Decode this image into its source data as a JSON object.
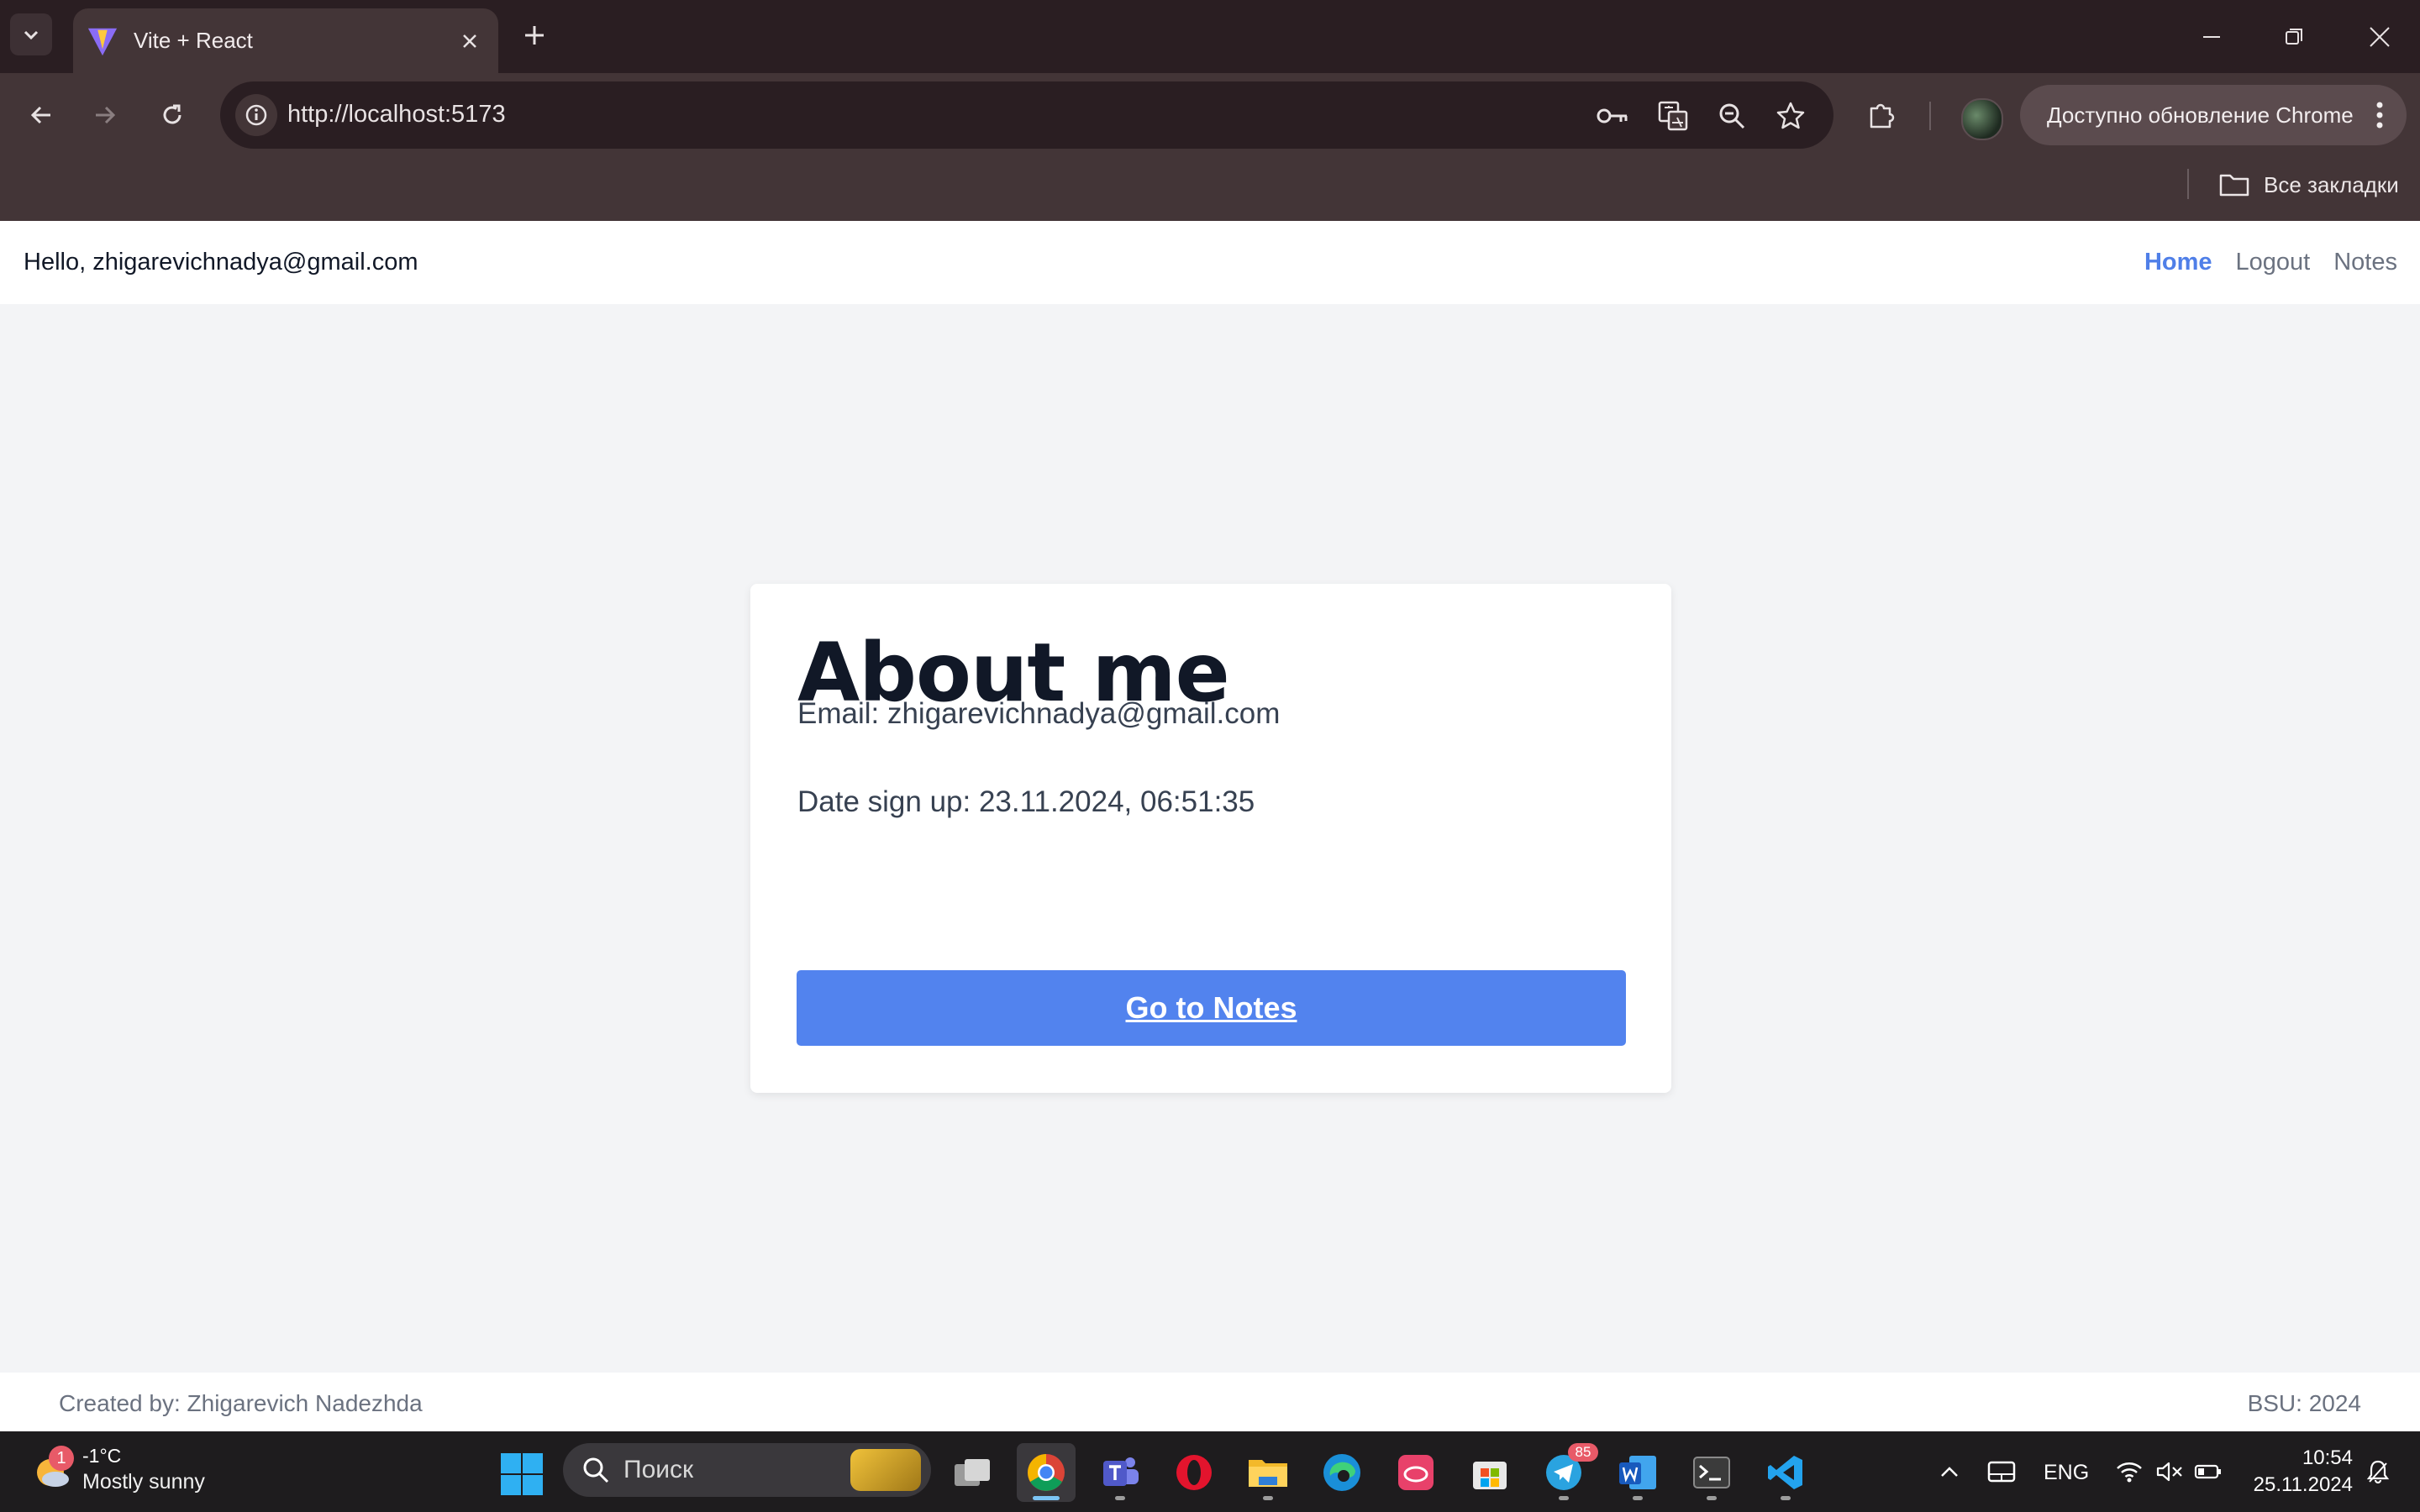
{
  "browser": {
    "tab_title": "Vite + React",
    "url": "http://localhost:5173",
    "update_button_label": "Доступно обновление Chrome",
    "bookmarks_all_label": "Все закладки",
    "icons": [
      "tab-search-icon",
      "vite-favicon",
      "close-icon",
      "new-tab-icon",
      "minimize-icon",
      "restore-icon",
      "window-close-icon",
      "back-icon",
      "forward-icon",
      "reload-icon",
      "site-info-icon",
      "password-key-icon",
      "translate-icon",
      "zoom-icon",
      "bookmark-star-icon",
      "extensions-icon",
      "profile-avatar",
      "more-menu-icon",
      "folder-icon"
    ]
  },
  "header": {
    "greeting": "Hello, zhigarevichnadya@gmail.com",
    "nav": {
      "home": "Home",
      "logout": "Logout",
      "notes": "Notes"
    }
  },
  "card": {
    "title": "About me",
    "email_line": "Email: zhigarevichnadya@gmail.com",
    "date_line": "Date sign up: 23.11.2024, 06:51:35",
    "button_label": "Go to Notes"
  },
  "footer": {
    "created_by": "Created by: Zhigarevich Nadezhda",
    "org": "BSU: 2024"
  },
  "taskbar": {
    "weather_badge": "1",
    "weather_temp": "-1°C",
    "weather_desc": "Mostly sunny",
    "search_placeholder": "Поиск",
    "telegram_badge": "85",
    "language": "ENG",
    "time": "10:54",
    "date": "25.11.2024"
  },
  "colors": {
    "accent": "#5283ee",
    "nav_active": "#4f7fe8",
    "chrome_dark": "#2a1e22",
    "chrome_toolbar": "#433537",
    "page_bg": "#f3f4f6"
  }
}
